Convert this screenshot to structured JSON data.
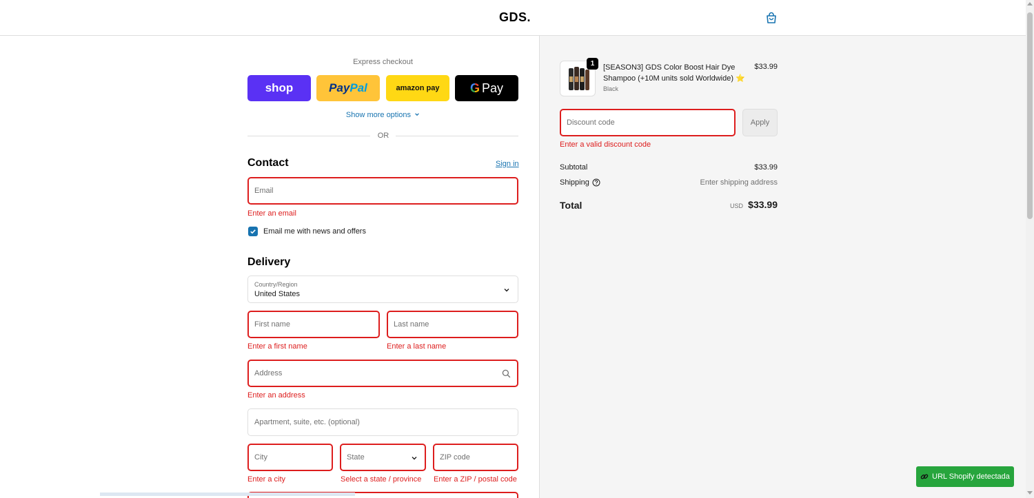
{
  "header": {
    "logo": "GDS."
  },
  "express": {
    "label": "Express checkout",
    "shop_label": "shop",
    "paypal_pay": "Pay",
    "paypal_pal": "Pal",
    "amazon_label": "amazon pay",
    "gpay_g": "G",
    "gpay_label": "Pay",
    "show_more": "Show more options",
    "or": "OR"
  },
  "contact": {
    "title": "Contact",
    "signin": "Sign in",
    "email_placeholder": "Email",
    "email_error": "Enter an email",
    "newsletter_label": "Email me with news and offers",
    "newsletter_checked": true
  },
  "delivery": {
    "title": "Delivery",
    "country_label": "Country/Region",
    "country_value": "United States",
    "first_name_placeholder": "First name",
    "first_name_error": "Enter a first name",
    "last_name_placeholder": "Last name",
    "last_name_error": "Enter a last name",
    "address_placeholder": "Address",
    "address_error": "Enter an address",
    "apartment_placeholder": "Apartment, suite, etc. (optional)",
    "city_placeholder": "City",
    "city_error": "Enter a city",
    "state_placeholder": "State",
    "state_error": "Select a state / province",
    "zip_placeholder": "ZIP code",
    "zip_error": "Enter a ZIP / postal code"
  },
  "cart": {
    "badge": "1",
    "product_name": "[SEASON3] GDS Color Boost Hair Dye Shampoo (+10M units sold Worldwide) ⭐",
    "variant": "Black",
    "price": "$33.99",
    "discount_placeholder": "Discount code",
    "discount_error": "Enter a valid discount code",
    "apply_label": "Apply"
  },
  "summary": {
    "subtotal_label": "Subtotal",
    "subtotal_value": "$33.99",
    "shipping_label": "Shipping",
    "shipping_value": "Enter shipping address",
    "total_label": "Total",
    "total_currency": "USD",
    "total_value": "$33.99"
  },
  "extension": {
    "label": "URL Shopify detectada"
  },
  "colors": {
    "accent": "#1773b0",
    "error": "#dd1d1d",
    "shop": "#5a31f4",
    "paypal": "#ffc439",
    "amazon": "#ffd814",
    "gpay": "#000000",
    "extension": "#27a53d"
  }
}
